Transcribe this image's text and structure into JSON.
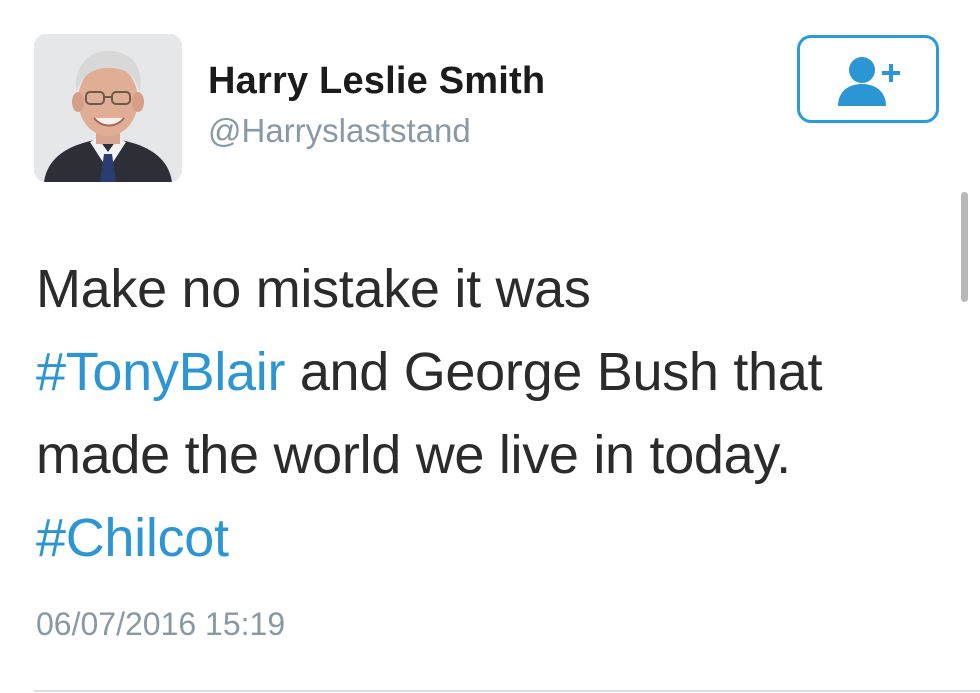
{
  "user": {
    "name": "Harry Leslie Smith",
    "handle": "@Harryslaststand"
  },
  "follow_button": {
    "icon": "add-user-icon"
  },
  "tweet": {
    "line1": "Make no mistake it was",
    "hashtag1": "#TonyBlair",
    "line2_rest": " and George Bush that",
    "line3": "made the world we live in today.",
    "hashtag2": "#Chilcot",
    "timestamp": "06/07/2016 15:19"
  },
  "colors": {
    "accent": "#2b96d3",
    "muted": "#8899a6",
    "text": "#2b2b2b"
  }
}
